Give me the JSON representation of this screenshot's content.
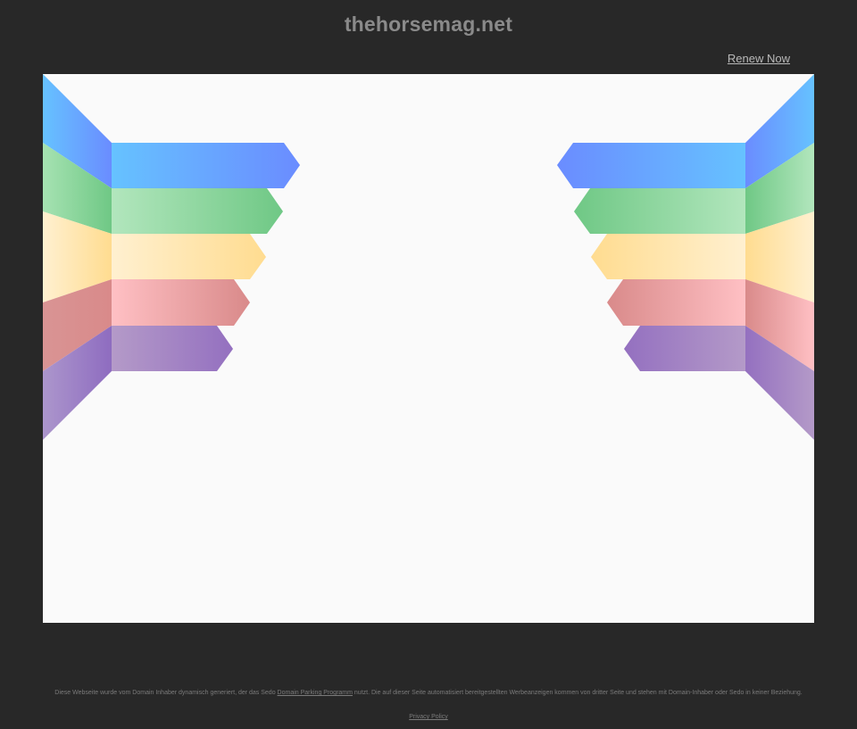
{
  "header": {
    "domain": "thehorsemag.net",
    "renew_label": "Renew Now"
  },
  "colors": {
    "background": "#282828",
    "frame": "#fafafa",
    "ribbon_blue": "#6699ff",
    "ribbon_green": "#7dcc8c",
    "ribbon_yellow": "#ffe8a8",
    "ribbon_red": "#e69090",
    "ribbon_purple": "#a07cc4"
  },
  "footer": {
    "text_before": "Diese Webseite wurde vom Domain Inhaber dynamisch generiert, der das Sedo ",
    "link_label": "Domain Parking Programm",
    "text_after": " nutzt. Die auf dieser Seite automatisiert bereitgestellten Werbeanzeigen kommen von dritter Seite und stehen mit Domain-Inhaber oder Sedo in keiner Beziehung.",
    "privacy_label": "Privacy Policy"
  }
}
